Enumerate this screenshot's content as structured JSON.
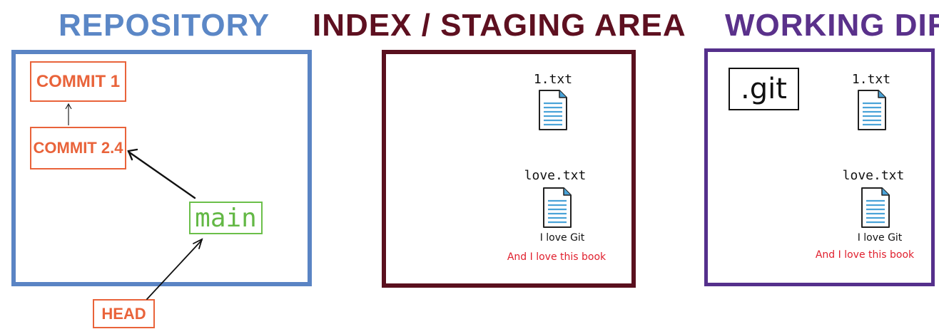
{
  "titles": {
    "repository": "REPOSITORY",
    "index": "INDEX / STAGING AREA",
    "working_dir": "WORKING DIR"
  },
  "repository": {
    "commit_1": "COMMIT 1",
    "commit_2": "COMMIT 2.4",
    "branch": "main",
    "head": "HEAD"
  },
  "index": {
    "file_1": {
      "name": "1.txt"
    },
    "file_2": {
      "name": "love.txt",
      "lines": [
        "I love Git",
        "And I love this book"
      ]
    }
  },
  "working_dir": {
    "git_folder": ".git",
    "file_1": {
      "name": "1.txt"
    },
    "file_2": {
      "name": "love.txt",
      "lines": [
        "I love Git",
        "And I love this book"
      ]
    }
  },
  "colors": {
    "repository": "#5b87c6",
    "index": "#5e1020",
    "working_dir": "#5a318b",
    "commit": "#e9633a",
    "branch": "#63b845",
    "added_line": "#e01f2d",
    "file_icon_lines": "#4aa3d8"
  },
  "icons": [
    "text-file-icon",
    "arrow-icon"
  ]
}
